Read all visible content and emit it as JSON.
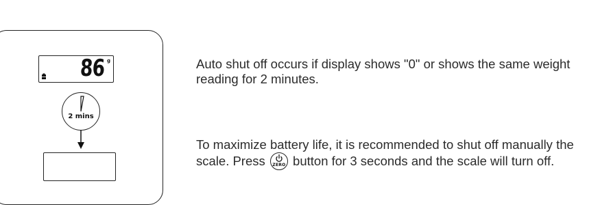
{
  "figure": {
    "lcd_reading": "86",
    "lcd_unit": "g",
    "timer_label": "2 mins"
  },
  "text": {
    "paragraph_1": "Auto shut off occurs if display shows \"0\" or shows the same weight reading for 2 minutes.",
    "paragraph_2_before": "To maximize battery life, it is recommended to shut off manually the scale. Press",
    "paragraph_2_after": "button for 3 seconds and the scale will turn off.",
    "zero_button_label": "ZERO"
  }
}
